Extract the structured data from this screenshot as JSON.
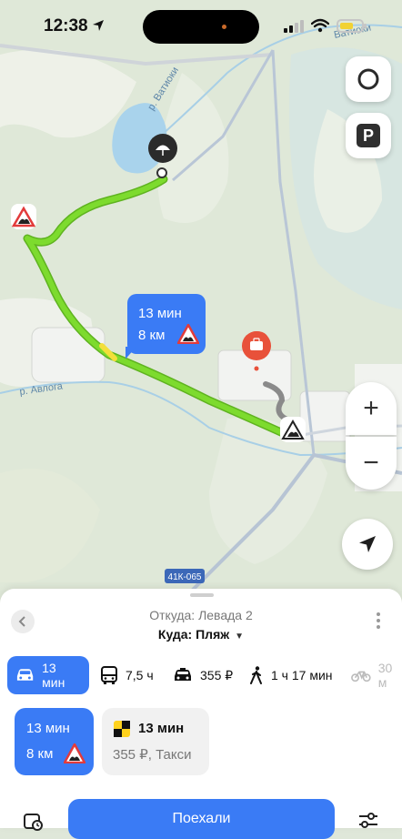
{
  "status_bar": {
    "time": "12:38"
  },
  "map": {
    "labels": {
      "river1": "р. Ватиоки",
      "river1_top": "Ватиоки",
      "river2": "р. Авлога",
      "road_badge": "41К-065"
    },
    "route_callout": {
      "duration": "13 мин",
      "distance": "8 км"
    },
    "colors": {
      "route": "#7ddb2e",
      "route_dim": "#8a8a8a",
      "accent": "#3a7bf5",
      "poi": "#e8513a"
    }
  },
  "sheet": {
    "from_label": "Откуда: Левада 2",
    "to_label": "Куда: Пляж",
    "modes": [
      {
        "icon": "car-icon",
        "label": "13 мин",
        "active": true
      },
      {
        "icon": "bus-icon",
        "label": "7,5 ч",
        "active": false
      },
      {
        "icon": "taxi-icon",
        "label": "355 ₽",
        "active": false
      },
      {
        "icon": "walk-icon",
        "label": "1 ч 17 мин",
        "active": false
      },
      {
        "icon": "bike-icon",
        "label": "30 м",
        "active": false
      }
    ],
    "options": [
      {
        "title": "13 мин",
        "subtitle": "8 км"
      },
      {
        "title": "13 мин",
        "subtitle": "355 ₽, Такси"
      }
    ],
    "go_button": "Поехали"
  }
}
